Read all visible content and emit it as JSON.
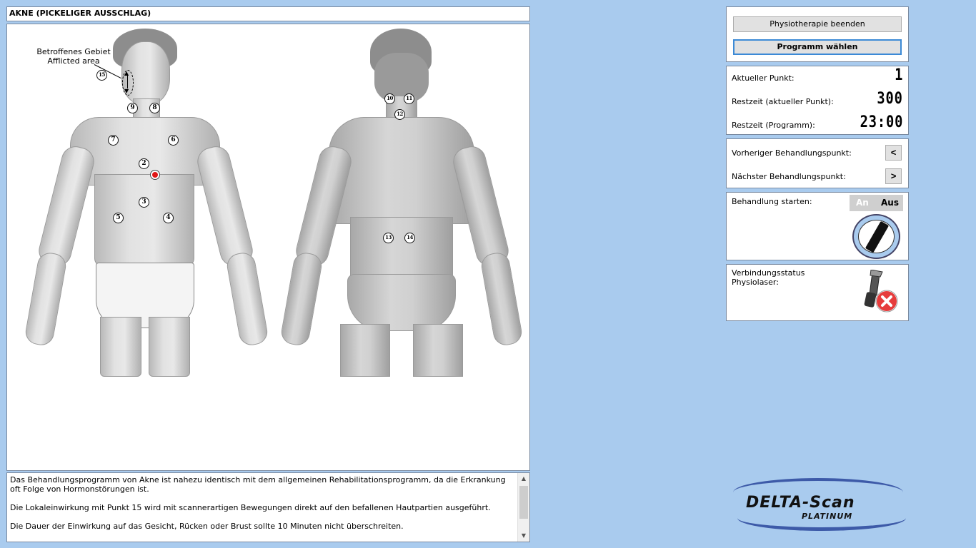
{
  "title": "AKNE (PICKELIGER AUSSCHLAG)",
  "diagram": {
    "afflicted_label_de": "Betroffenes Gebiet",
    "afflicted_label_en": "Afflicted area",
    "points_front": [
      "15",
      "9",
      "8",
      "7",
      "6",
      "2",
      "3",
      "5",
      "4"
    ],
    "points_back": [
      "10",
      "11",
      "12",
      "13",
      "14"
    ]
  },
  "description": {
    "paragraphs": [
      "Das Behandlungsprogramm von Akne ist nahezu identisch mit dem allgemeinen Rehabilitationsprogramm, da die Erkrankung oft Folge von Hormonstörungen ist.",
      "Die Lokaleinwirkung mit Punkt 15 wird mit scannerartigen Bewegungen direkt auf den befallenen Hautpartien ausgeführt.",
      "Die Dauer der Einwirkung auf das Gesicht, Rücken oder Brust sollte 10 Minuten nicht überschreiten."
    ]
  },
  "actions": {
    "end_label": "Physiotherapie beenden",
    "choose_label": "Programm wählen"
  },
  "status": {
    "current_point_label": "Aktueller Punkt:",
    "current_point_value": "1",
    "remaining_point_label": "Restzeit (aktueller Punkt):",
    "remaining_point_value": "300",
    "remaining_program_label": "Restzeit (Programm):",
    "remaining_program_value": "23:00"
  },
  "navigation": {
    "prev_label": "Vorheriger Behandlungspunkt:",
    "prev_button": "<",
    "next_label": "Nächster Behandlungspunkt:",
    "next_button": ">"
  },
  "treatment": {
    "start_label": "Behandlung starten:",
    "on_label": "An",
    "off_label": "Aus",
    "state": "Aus"
  },
  "connection": {
    "label_line1": "Verbindungsstatus",
    "label_line2": "Physiolaser:",
    "status_icon": "laser-disconnected-icon"
  },
  "logo": {
    "text": "DELTA-Scan",
    "sub": "PLATINUM"
  },
  "colors": {
    "background": "#a9cbee",
    "accent": "#3c8ad6",
    "active_point": "#e01515",
    "logo_blue": "#3d5aa8"
  }
}
